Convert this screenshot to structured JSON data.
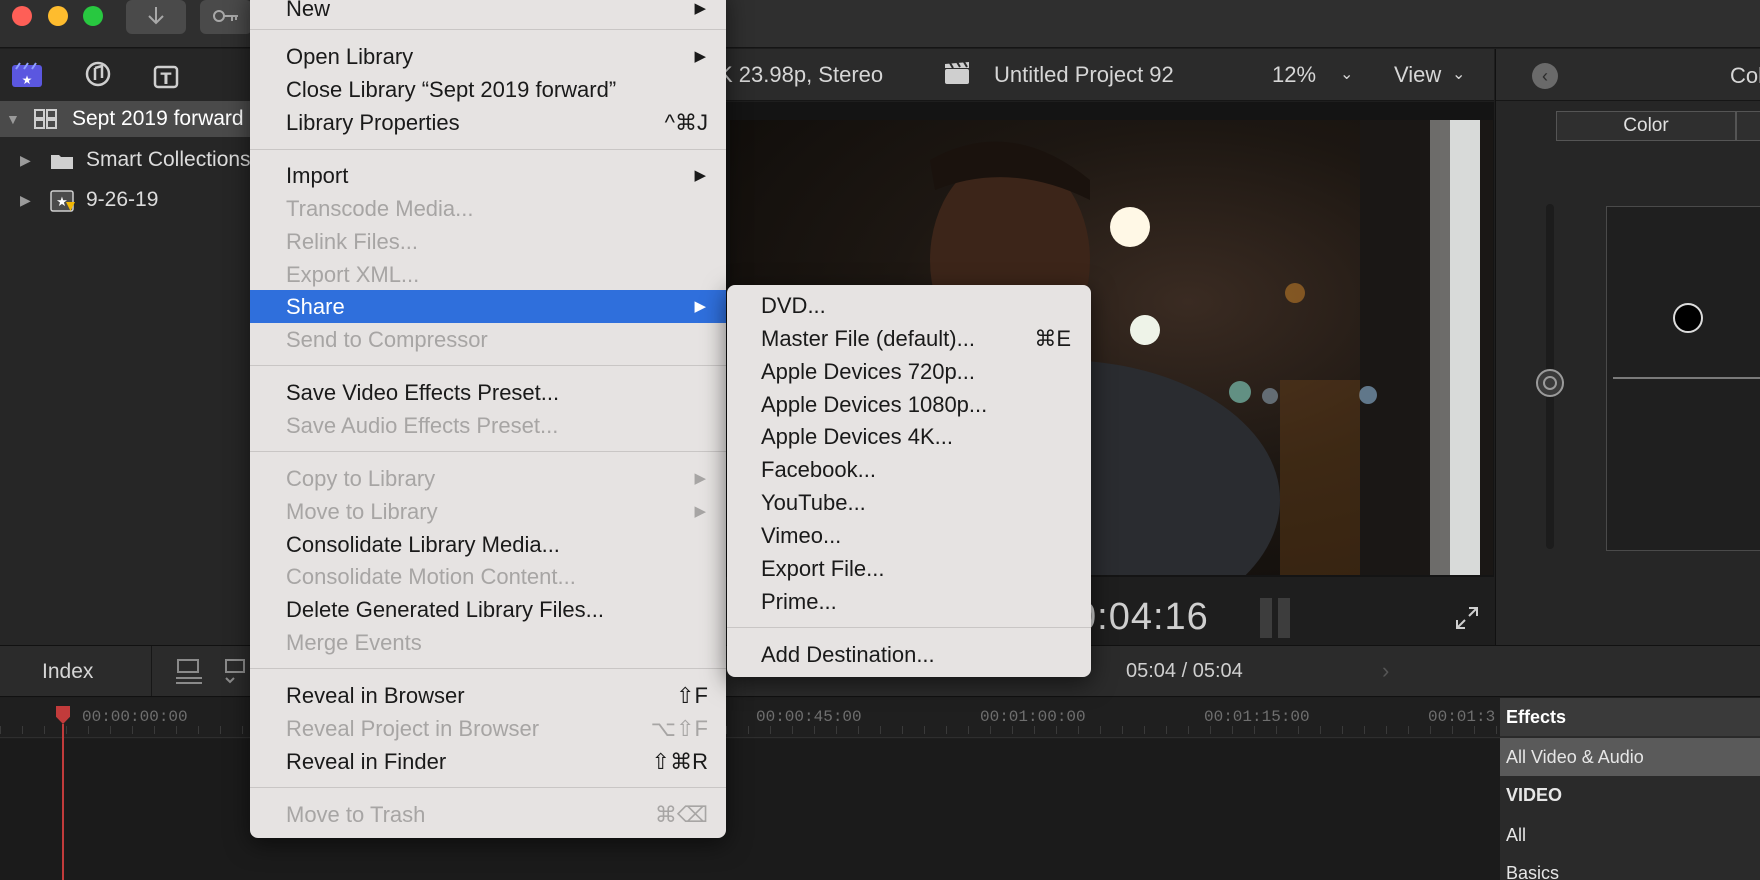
{
  "titlebar": {
    "import_icon": "down-arrow-icon",
    "keywords_icon": "key-icon"
  },
  "sidebar": {
    "library_name": "Sept 2019 forward",
    "items": [
      {
        "label": "Smart Collections"
      },
      {
        "label": "9-26-19"
      }
    ]
  },
  "viewer": {
    "format": "K 23.98p, Stereo",
    "project_name": "Untitled Project 92",
    "zoom": "12%",
    "view_label": "View",
    "timecode": "0:04:16"
  },
  "inspector": {
    "title": "Col",
    "tab": "Color"
  },
  "timeline": {
    "index_label": "Index",
    "duration": "05:04 / 05:04",
    "ruler_ticks": [
      "00:00:00:00",
      "00:00:45:00",
      "00:01:00:00",
      "00:01:15:00",
      "00:01:3"
    ]
  },
  "effects_browser": {
    "title": "Effects",
    "rows": [
      "All Video & Audio",
      "VIDEO",
      "All",
      "Basics"
    ]
  },
  "file_menu": {
    "items": [
      {
        "label": "New",
        "shortcut": "",
        "submenu": true,
        "enabled": true
      },
      {
        "label": "Open Library",
        "shortcut": "",
        "submenu": true,
        "enabled": true
      },
      {
        "label": "Close Library “Sept 2019 forward”",
        "shortcut": "",
        "submenu": false,
        "enabled": true
      },
      {
        "label": "Library Properties",
        "shortcut": "^⌘J",
        "submenu": false,
        "enabled": true
      },
      {
        "label": "Import",
        "shortcut": "",
        "submenu": true,
        "enabled": true
      },
      {
        "label": "Transcode Media...",
        "shortcut": "",
        "submenu": false,
        "enabled": false
      },
      {
        "label": "Relink Files...",
        "shortcut": "",
        "submenu": false,
        "enabled": false
      },
      {
        "label": "Export XML...",
        "shortcut": "",
        "submenu": false,
        "enabled": false
      },
      {
        "label": "Share",
        "shortcut": "",
        "submenu": true,
        "enabled": true,
        "highlighted": true
      },
      {
        "label": "Send to Compressor",
        "shortcut": "",
        "submenu": false,
        "enabled": false
      },
      {
        "label": "Save Video Effects Preset...",
        "shortcut": "",
        "submenu": false,
        "enabled": true
      },
      {
        "label": "Save Audio Effects Preset...",
        "shortcut": "",
        "submenu": false,
        "enabled": false
      },
      {
        "label": "Copy to Library",
        "shortcut": "",
        "submenu": true,
        "enabled": false
      },
      {
        "label": "Move to Library",
        "shortcut": "",
        "submenu": true,
        "enabled": false
      },
      {
        "label": "Consolidate Library Media...",
        "shortcut": "",
        "submenu": false,
        "enabled": true
      },
      {
        "label": "Consolidate Motion Content...",
        "shortcut": "",
        "submenu": false,
        "enabled": false
      },
      {
        "label": "Delete Generated Library Files...",
        "shortcut": "",
        "submenu": false,
        "enabled": true
      },
      {
        "label": "Merge Events",
        "shortcut": "",
        "submenu": false,
        "enabled": false
      },
      {
        "label": "Reveal in Browser",
        "shortcut": "⇧F",
        "submenu": false,
        "enabled": true
      },
      {
        "label": "Reveal Project in Browser",
        "shortcut": "⌥⇧F",
        "submenu": false,
        "enabled": false
      },
      {
        "label": "Reveal in Finder",
        "shortcut": "⇧⌘R",
        "submenu": false,
        "enabled": true
      },
      {
        "label": "Move to Trash",
        "shortcut": "⌘⌫",
        "submenu": false,
        "enabled": false
      }
    ]
  },
  "share_menu": {
    "items": [
      {
        "label": "DVD...",
        "shortcut": ""
      },
      {
        "label": "Master File (default)...",
        "shortcut": "⌘E"
      },
      {
        "label": "Apple Devices 720p...",
        "shortcut": ""
      },
      {
        "label": "Apple Devices 1080p...",
        "shortcut": ""
      },
      {
        "label": "Apple Devices 4K...",
        "shortcut": ""
      },
      {
        "label": "Facebook...",
        "shortcut": ""
      },
      {
        "label": "YouTube...",
        "shortcut": ""
      },
      {
        "label": "Vimeo...",
        "shortcut": ""
      },
      {
        "label": "Export File...",
        "shortcut": ""
      },
      {
        "label": "Prime...",
        "shortcut": ""
      },
      {
        "label": "Add Destination...",
        "shortcut": ""
      }
    ]
  },
  "colors": {
    "highlight": "#2f6fdc",
    "menu_bg": "#e6e3e2",
    "close": "#fe5f57",
    "minimize": "#febc2e",
    "zoom": "#28c840"
  }
}
